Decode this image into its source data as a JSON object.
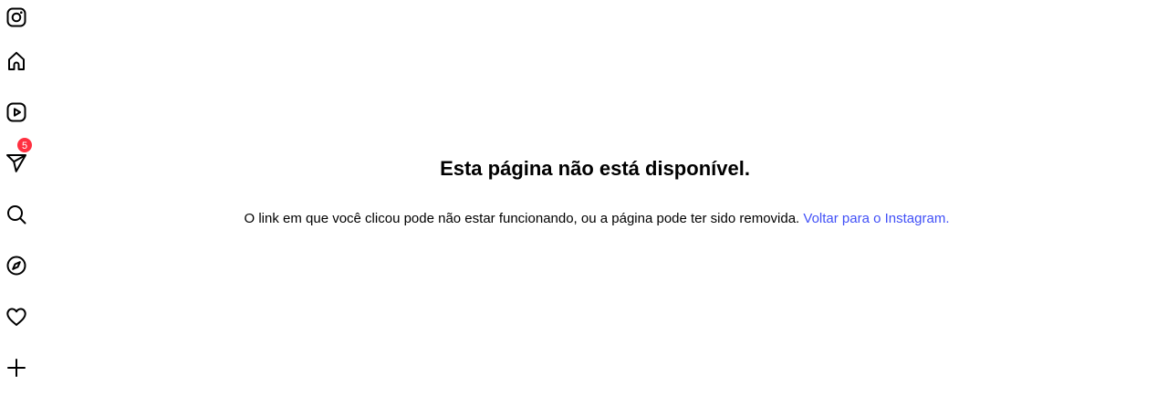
{
  "sidebar": {
    "items": [
      {
        "name": "instagram-logo-icon"
      },
      {
        "name": "home-icon"
      },
      {
        "name": "reels-icon"
      },
      {
        "name": "messages-icon",
        "badge": "5"
      },
      {
        "name": "search-icon"
      },
      {
        "name": "explore-icon"
      },
      {
        "name": "notifications-icon"
      },
      {
        "name": "create-icon"
      }
    ]
  },
  "main": {
    "title": "Esta página não está disponível.",
    "message": "O link em que você clicou pode não estar funcionando, ou a página pode ter sido removida.",
    "link_text": "Voltar para o Instagram."
  },
  "colors": {
    "link": "#4150f7",
    "badge": "#ff3040"
  }
}
